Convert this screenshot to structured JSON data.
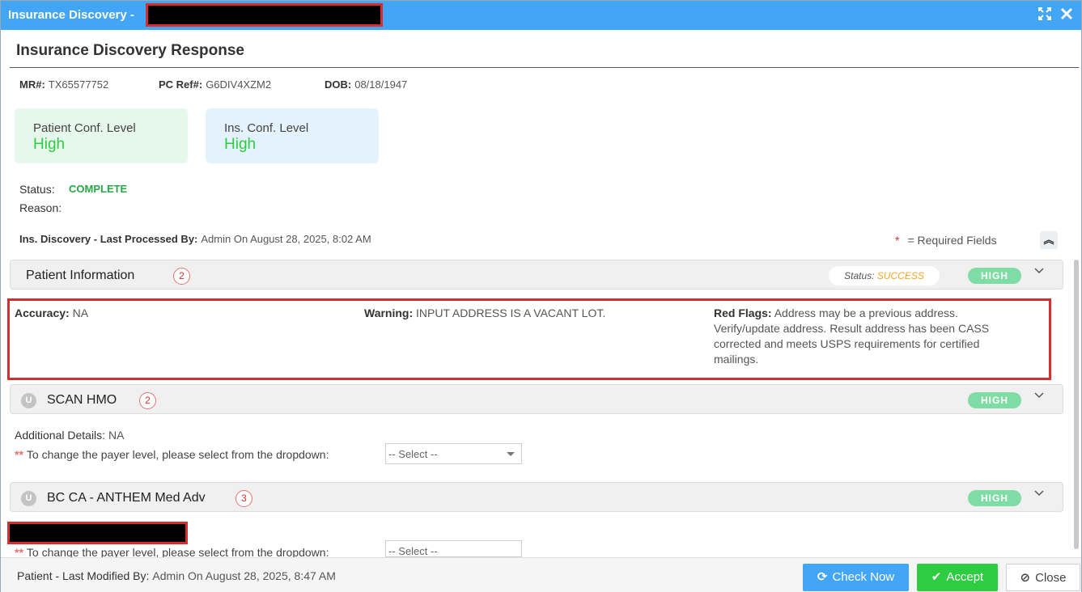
{
  "window": {
    "title": "Insurance Discovery -",
    "icons": {
      "maximize": "expand-arrows-icon",
      "close": "close-x-icon"
    },
    "accent_color": "#42a5f5"
  },
  "header": {
    "title": "Insurance Discovery Response"
  },
  "patient": {
    "mr_label": "MR#:",
    "mr_value": "TX65577752",
    "pcref_label": "PC Ref#:",
    "pcref_value": "G6DIV4XZM2",
    "dob_label": "DOB:",
    "dob_value": "08/18/1947"
  },
  "confidence": {
    "patient_label": "Patient Conf. Level",
    "patient_value": "High",
    "ins_label": "Ins. Conf. Level",
    "ins_value": "High"
  },
  "status": {
    "status_label": "Status:",
    "status_value": "COMPLETE",
    "reason_label": "Reason:"
  },
  "processed": {
    "label": "Ins. Discovery - Last Processed By:",
    "value": "Admin On August 28, 2025, 8:02 AM"
  },
  "required": {
    "star": "*",
    "text": "= Required Fields"
  },
  "sections": [
    {
      "name": "Patient Information",
      "badge": "2",
      "status_label": "Status:",
      "status_value": "SUCCESS",
      "level": "HIGH",
      "accuracy_label": "Accuracy:",
      "accuracy_value": "NA",
      "warning_label": "Warning:",
      "warning_value": "INPUT ADDRESS IS A VACANT LOT.",
      "redflags_label": "Red Flags:",
      "redflags_value": "Address may be a previous address. Verify/update address. Result address has been CASS corrected and meets USPS requirements for certified mailings."
    },
    {
      "name": "SCAN HMO",
      "u_badge": "U",
      "badge": "2",
      "level": "HIGH",
      "details_label": "Additional Details:",
      "details_value": "NA",
      "payer_stars": "**",
      "payer_text": "To change the payer level, please select from the dropdown:",
      "select_value": "-- Select --"
    },
    {
      "name": "BC CA - ANTHEM Med Adv",
      "u_badge": "U",
      "badge": "3",
      "level": "HIGH",
      "payer_stars": "**",
      "payer_text": "To change the payer level, please select from the dropdown:",
      "select_value": "-- Select --"
    }
  ],
  "footer": {
    "modified_label": "Patient - Last Modified By:",
    "modified_value": "Admin On August 28, 2025, 8:47 AM",
    "check_now": "Check Now",
    "accept": "Accept",
    "close": "Close"
  }
}
